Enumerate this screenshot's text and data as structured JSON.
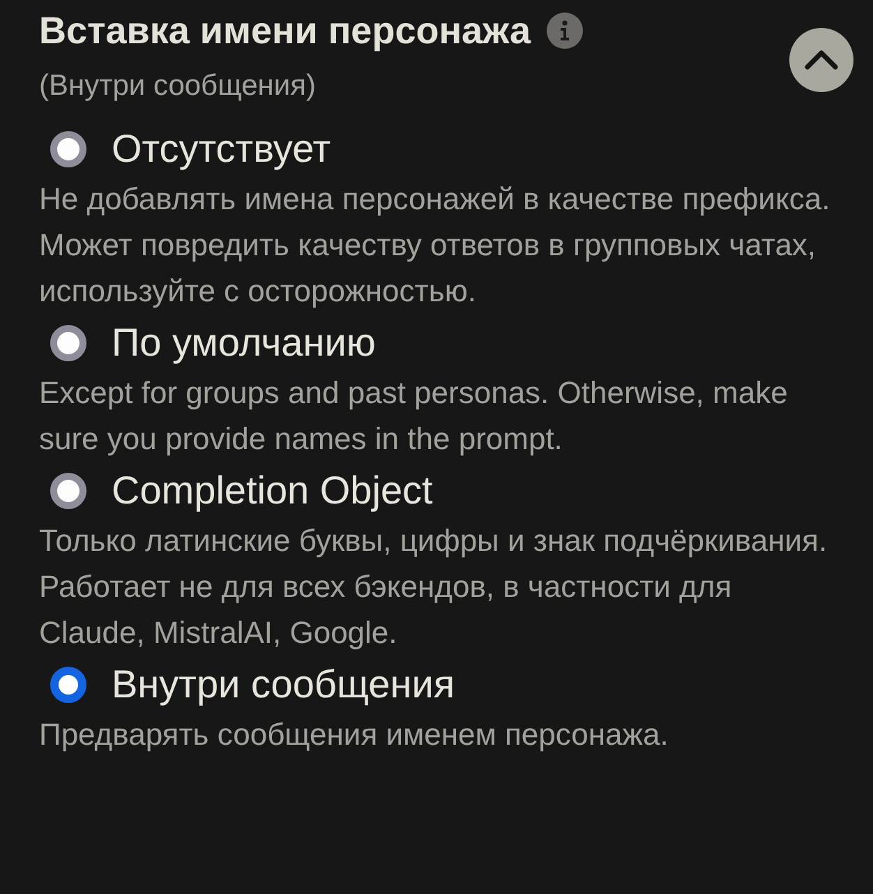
{
  "title": "Вставка имени персонажа",
  "subtitle": "(Внутри сообщения)",
  "collapse": {
    "expanded": true
  },
  "options": [
    {
      "label": "Отсутствует",
      "selected": false,
      "description": "Не добавлять имена персонажей в качестве префикса. Может повредить качеству ответов в групповых чатах, используйте с осторожностью."
    },
    {
      "label": "По умолчанию",
      "selected": false,
      "description": "Except for groups and past personas. Otherwise, make sure you provide names in the prompt."
    },
    {
      "label": "Completion Object",
      "selected": false,
      "description": "Только латинские буквы, цифры и знак подчёркивания. Работает не для всех бэкендов, в частности для Claude, MistralAI, Google."
    },
    {
      "label": "Внутри сообщения",
      "selected": true,
      "description": "Предварять сообщения именем персонажа."
    }
  ]
}
